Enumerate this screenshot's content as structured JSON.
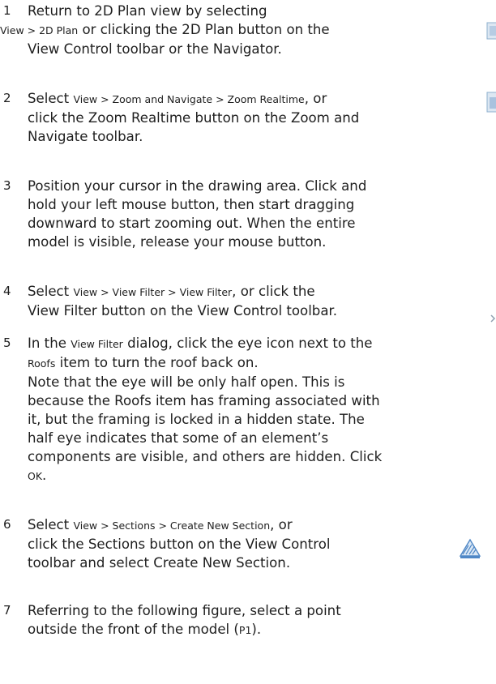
{
  "steps": [
    {
      "num": "1",
      "lines": [
        [
          {
            "t": "Return to 2D Plan view by selecting"
          }
        ],
        [
          {
            "t": "View > 2D Plan",
            "m": true
          },
          {
            "t": " or clicking the 2D Plan button on the"
          }
        ],
        [
          {
            "t": "View Control toolbar or the Navigator."
          }
        ]
      ]
    },
    {
      "num": "2",
      "lines": [
        [
          {
            "t": "Select "
          },
          {
            "t": "View > Zoom and Navigate > Zoom Realtime",
            "m": true
          },
          {
            "t": ", or"
          }
        ],
        [
          {
            "t": "click the Zoom Realtime button on the Zoom and"
          }
        ],
        [
          {
            "t": "Navigate toolbar."
          }
        ]
      ]
    },
    {
      "num": "3",
      "lines": [
        [
          {
            "t": "Position your cursor in the drawing area. Click and"
          }
        ],
        [
          {
            "t": "hold your left mouse button, then start dragging"
          }
        ],
        [
          {
            "t": "downward to start zooming out. When the entire"
          }
        ],
        [
          {
            "t": "model is visible, release your mouse button."
          }
        ]
      ]
    },
    {
      "num": "4",
      "lines": [
        [
          {
            "t": "Select "
          },
          {
            "t": "View > View Filter > View Filter",
            "m": true
          },
          {
            "t": ", or click the"
          }
        ],
        [
          {
            "t": "View Filter button on the View Control toolbar."
          }
        ]
      ]
    },
    {
      "num": "5",
      "lines": [
        [
          {
            "t": "In the "
          },
          {
            "t": "View Filter",
            "m": true
          },
          {
            "t": " dialog, click the eye icon next to the"
          }
        ],
        [
          {
            "t": "Roofs",
            "m": true
          },
          {
            "t": " item to turn the roof back on."
          }
        ],
        [
          {
            "t": "Note that the eye will be only half open. This is"
          }
        ],
        [
          {
            "t": "because the Roofs item has framing associated with"
          }
        ],
        [
          {
            "t": "it, but the framing is locked in a hidden state. The"
          }
        ],
        [
          {
            "t": "half eye indicates that some of an element’s"
          }
        ],
        [
          {
            "t": "components are visible, and others are hidden. Click"
          }
        ],
        [
          {
            "t": "OK",
            "m": true
          },
          {
            "t": "."
          }
        ]
      ]
    },
    {
      "num": "6",
      "lines": [
        [
          {
            "t": "Select "
          },
          {
            "t": "View > Sections > Create New Section",
            "m": true
          },
          {
            "t": ", or"
          }
        ],
        [
          {
            "t": "click the Sections button on the View Control"
          }
        ],
        [
          {
            "t": "toolbar and select Create New Section."
          }
        ]
      ]
    },
    {
      "num": "7",
      "lines": [
        [
          {
            "t": "Referring to the following figure, select a point"
          }
        ],
        [
          {
            "t": "outside the front of the model ("
          },
          {
            "t": "P1",
            "m": true
          },
          {
            "t": ")."
          }
        ]
      ]
    }
  ],
  "icons": {
    "edge_icon_color": "#8fb0cf",
    "sections_icon_color": "#4f87c6"
  }
}
